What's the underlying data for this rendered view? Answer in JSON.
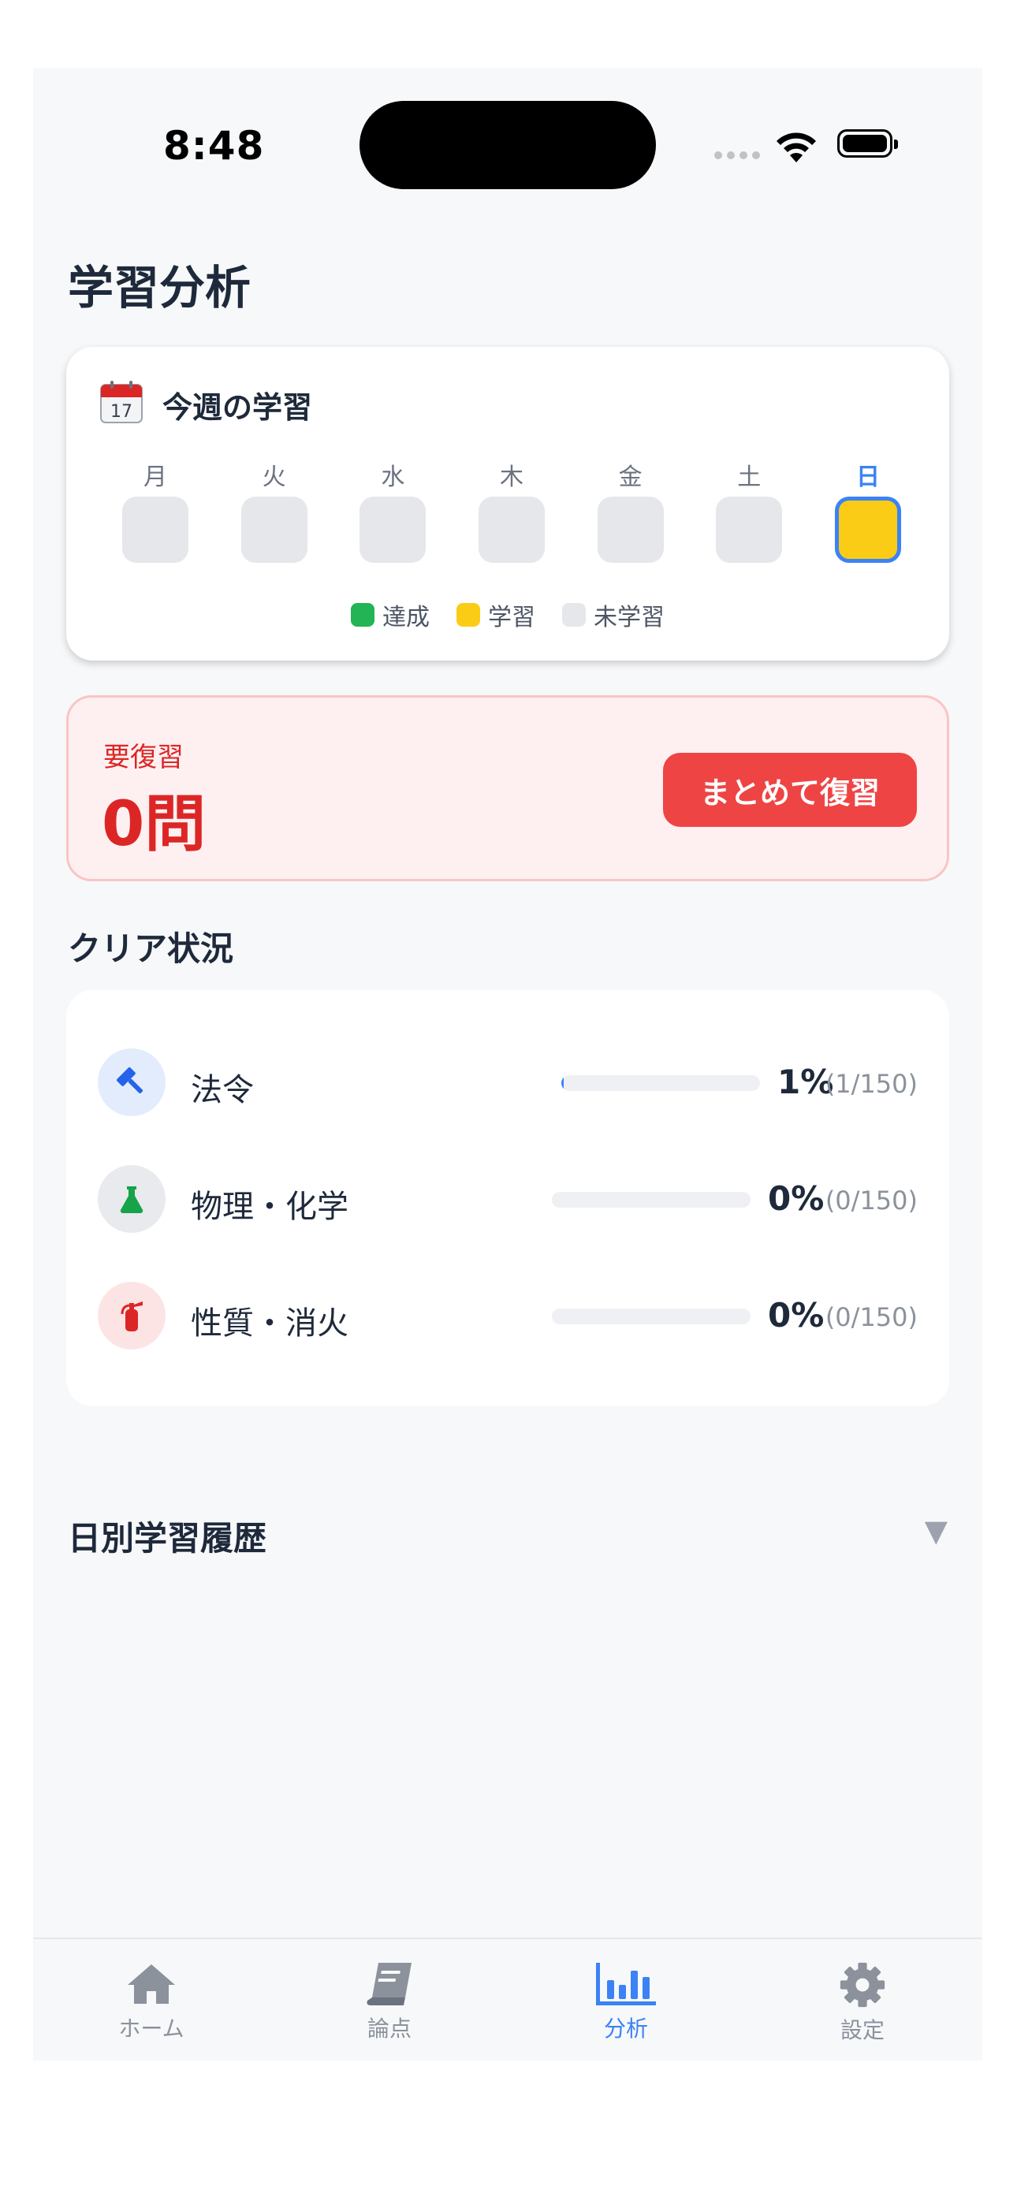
{
  "status_bar": {
    "time": "8:48"
  },
  "page": {
    "title": "学習分析"
  },
  "week": {
    "title": "今週の学習",
    "days": [
      {
        "label": "月",
        "state": "未学習"
      },
      {
        "label": "火",
        "state": "未学習"
      },
      {
        "label": "水",
        "state": "未学習"
      },
      {
        "label": "木",
        "state": "未学習"
      },
      {
        "label": "金",
        "state": "未学習"
      },
      {
        "label": "土",
        "state": "未学習"
      },
      {
        "label": "日",
        "state": "学習",
        "today": true
      }
    ],
    "legend": [
      {
        "label": "達成",
        "color": "#22b455"
      },
      {
        "label": "学習",
        "color": "#facc15"
      },
      {
        "label": "未学習",
        "color": "#e5e7eb"
      }
    ]
  },
  "review": {
    "label": "要復習",
    "count": "0問",
    "button": "まとめて復習"
  },
  "clear_status": {
    "title": "クリア状況",
    "subjects": [
      {
        "name": "法令",
        "percent_text": "1%",
        "fraction": "(1/150)",
        "progress": 0.0067,
        "icon": "gavel-icon"
      },
      {
        "name": "物理・化学",
        "percent_text": "0%",
        "fraction": "(0/150)",
        "progress": 0,
        "icon": "flask-icon"
      },
      {
        "name": "性質・消火",
        "percent_text": "0%",
        "fraction": "(0/150)",
        "progress": 0,
        "icon": "fire-extinguisher-icon"
      }
    ]
  },
  "history": {
    "title": "日別学習履歴",
    "caret": "▼"
  },
  "tabs": [
    {
      "label": "ホーム",
      "icon": "home-icon"
    },
    {
      "label": "論点",
      "icon": "book-icon"
    },
    {
      "label": "分析",
      "icon": "chart-bar-icon",
      "active": true
    },
    {
      "label": "設定",
      "icon": "gear-icon"
    }
  ],
  "colors": {
    "accent": "#3b82f6",
    "danger": "#ef4444",
    "study": "#facc15"
  }
}
